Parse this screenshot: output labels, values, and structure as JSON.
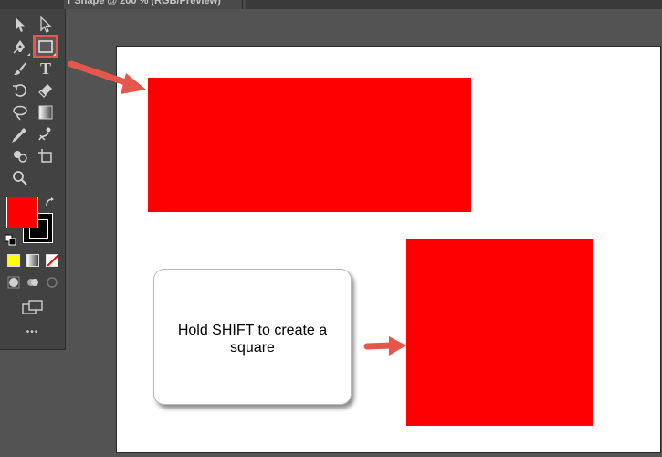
{
  "window": {
    "tab_title": "r Shape  @ 200 % (RGB/Preview)"
  },
  "toolbar": {
    "tools": [
      {
        "name": "selection-tool",
        "icon": "selection-arrow-icon"
      },
      {
        "name": "direct-selection-tool",
        "icon": "direct-selection-arrow-icon"
      },
      {
        "name": "pen-tool",
        "icon": "pen-icon"
      },
      {
        "name": "rectangle-tool",
        "icon": "rectangle-icon",
        "selected": true
      },
      {
        "name": "paintbrush-tool",
        "icon": "paintbrush-icon"
      },
      {
        "name": "type-tool",
        "icon": "type-icon"
      },
      {
        "name": "rotate-tool",
        "icon": "rotate-icon"
      },
      {
        "name": "eraser-tool",
        "icon": "eraser-icon"
      },
      {
        "name": "lasso-tool",
        "icon": "lasso-icon"
      },
      {
        "name": "gradient-tool",
        "icon": "gradient-icon"
      },
      {
        "name": "eyedropper-tool",
        "icon": "eyedropper-icon"
      },
      {
        "name": "puppet-warp-tool",
        "icon": "puppet-warp-icon"
      },
      {
        "name": "shape-builder-tool",
        "icon": "shape-builder-icon"
      },
      {
        "name": "artboard-tool",
        "icon": "artboard-icon"
      },
      {
        "name": "zoom-tool",
        "icon": "zoom-icon"
      }
    ],
    "type_tool_glyph": "T",
    "fill_color": "#ff0000",
    "stroke_color": "#000000",
    "more_glyph": "•••"
  },
  "canvas": {
    "shape_color": "#ff0000",
    "callout_text": "Hold SHIFT to create a square"
  },
  "colors": {
    "arrow": "#e5574b",
    "panel": "#424242",
    "workspace": "#535353"
  }
}
